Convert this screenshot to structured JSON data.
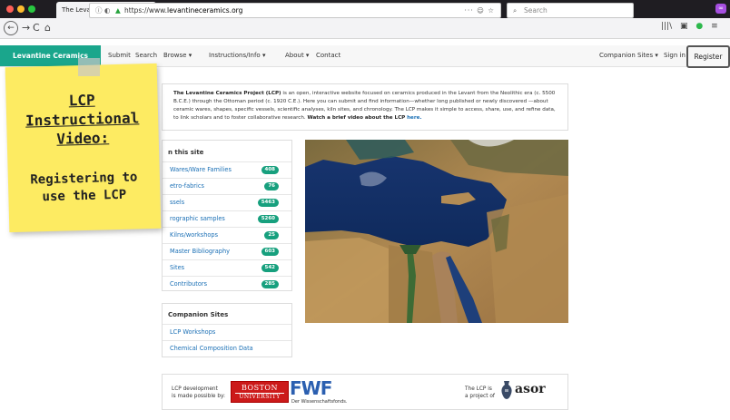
{
  "browser": {
    "tab_title": "The Levantine Ceramics Project",
    "tab_close": "×",
    "new_tab": "+",
    "url_scheme": "https://www.",
    "url_host": "levantineceramics.org",
    "url_actions": "··· ☺ ☆",
    "search_placeholder": "Search",
    "extension_badge": "∞"
  },
  "site_nav": {
    "brand": "Levantine Ceramics Project",
    "items": [
      "Submit",
      "Search",
      "Browse ▾",
      "Instructions/Info ▾",
      "About ▾",
      "Contact"
    ],
    "companion": "Companion Sites ▾",
    "signin": "Sign in",
    "register": "Register"
  },
  "intro": {
    "bold_lead": "The Levantine Ceramics Project (LCP)",
    "text": " is an open, interactive website focused on ceramics produced in the Levant from the Neolithic era (c. 5500 B.C.E.) through the Ottoman period (c. 1920 C.E.). Here you can submit and find information—whether long published or newly discovered —about ceramic wares, shapes, specific vessels, scientific analyses, kiln sites, and chronology. The LCP makes it simple to access, share, use, and refine data, to link scholars and to foster collaborative research. ",
    "bold_tail": "Watch a brief video about the LCP",
    "link": "here."
  },
  "on_this_site": {
    "heading": "n this site",
    "rows": [
      {
        "label": "Wares/Ware Families",
        "count": "408"
      },
      {
        "label": "etro-fabrics",
        "count": "76"
      },
      {
        "label": "ssels",
        "count": "5463"
      },
      {
        "label": "rographic samples",
        "count": "5260"
      },
      {
        "label": "Kilns/workshops",
        "count": "25"
      },
      {
        "label": "Master Bibliography",
        "count": "603"
      },
      {
        "label": "Sites",
        "count": "542"
      },
      {
        "label": "Contributors",
        "count": "285"
      }
    ]
  },
  "companion_sites": {
    "heading": "Companion Sites",
    "rows": [
      "LCP Workshops",
      "Chemical Composition Data"
    ]
  },
  "sticky_note": {
    "title_lines": [
      "LCP",
      "Instructional",
      "Video:"
    ],
    "body_lines": [
      "Registering to",
      "use the LCP"
    ]
  },
  "footer": {
    "dev_line1": "LCP development",
    "dev_line2": "is made possible by:",
    "bu_line1": "BOSTON",
    "bu_line2": "UNIVERSITY",
    "fwf": "FWF",
    "fwf_sub": "Der Wissenschaftsfonds.",
    "proj_line1": "The LCP is",
    "proj_line2": "a project of",
    "asor": "asor"
  },
  "colors": {
    "brand_green": "#1aa68c",
    "badge_green": "#17a07e",
    "link_blue": "#1a6fb5",
    "sticky_yellow": "#fdeb62"
  }
}
